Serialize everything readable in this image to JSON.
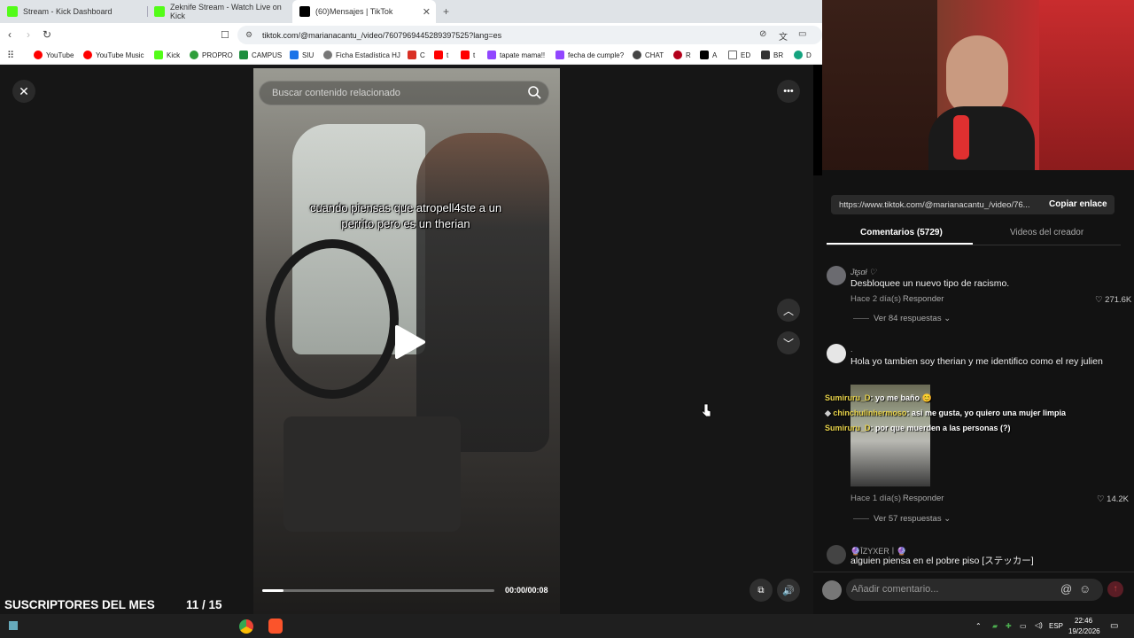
{
  "browser": {
    "tabs": [
      {
        "title": "Stream - Kick Dashboard",
        "icon": "kick-icon",
        "active": false
      },
      {
        "title": "Zeknife Stream - Watch Live on Kick",
        "icon": "kick-icon",
        "active": false
      },
      {
        "title": "(60)Mensajes | TikTok",
        "icon": "tiktok-icon",
        "active": true
      }
    ],
    "url": "tiktok.com/@marianacantu_/video/7607969445289397525?lang=es",
    "bookmarks": [
      {
        "label": "YouTube",
        "color": "#ff0000"
      },
      {
        "label": "YouTube Music",
        "color": "#ff0000"
      },
      {
        "label": "Kick",
        "color": "#53fc18"
      },
      {
        "label": "PROPRO",
        "color": "#2e9e3a"
      },
      {
        "label": "CAMPUS",
        "color": "#1e8e3e"
      },
      {
        "label": "SIU",
        "color": "#1a73e8"
      },
      {
        "label": "Ficha Estadística HJ",
        "color": "#777777"
      },
      {
        "label": "C",
        "color": "#d93025"
      },
      {
        "label": "t",
        "color": "#ff0000"
      },
      {
        "label": "t",
        "color": "#ff0000"
      },
      {
        "label": "tapate mama!!",
        "color": "#9146ff"
      },
      {
        "label": "fecha de cumple?",
        "color": "#9146ff"
      },
      {
        "label": "CHAT",
        "color": "#444444"
      },
      {
        "label": "R",
        "color": "#b3001b"
      },
      {
        "label": "A",
        "color": "#000000"
      },
      {
        "label": "ED",
        "color": "#666666"
      },
      {
        "label": "BR",
        "color": "#333333"
      },
      {
        "label": "D",
        "color": "#14a37f"
      }
    ]
  },
  "tiktok": {
    "search_placeholder": "Buscar contenido relacionado",
    "caption": "cuando piensas que atropell4ste a un perrito pero es un therian",
    "time": "00:00/00:08",
    "progress": 0.09,
    "link": "https://www.tiktok.com/@marianacantu_/video/76...",
    "copy_link": "Copiar enlace",
    "tab_comments": "Comentarios (5729)",
    "tab_videos": "Videos del creador",
    "comment_placeholder": "Añadir comentario...",
    "comments": [
      {
        "user": "Jŧʂɑł ♡",
        "text": "Desbloquee un nuevo tipo de racismo.",
        "time": "Hace 2 día(s)",
        "reply": "Responder",
        "likes": "271.6K",
        "more": "Ver 84 respuestas"
      },
      {
        "user": ".",
        "text": "Hola yo tambien soy therian y me identifico como el rey julien",
        "time": "Hace 1 día(s)",
        "reply": "Responder",
        "likes": "14.2K",
        "more": "Ver 57 respuestas"
      },
      {
        "user": "🔮ĪZYXERㅣ🔮",
        "text": "alguien piensa en el pobre piso [ステッカー]"
      }
    ]
  },
  "chat_overlay": [
    {
      "user": "Sumiruru_D",
      "msg": ": yo me baño 😊"
    },
    {
      "user": "chinchulinhermoso",
      "msg": ": asi me gusta, yo quiero una mujer limpia"
    },
    {
      "user": "Sumiruru_D",
      "msg": ": por que muerden a las personas (?)"
    }
  ],
  "stream": {
    "subs_title": "SUSCRIPTORES DEL MES",
    "subs_count": "11 / 15"
  },
  "taskbar": {
    "lang": "ESP",
    "time": "22:46",
    "date": "19/2/2026"
  }
}
